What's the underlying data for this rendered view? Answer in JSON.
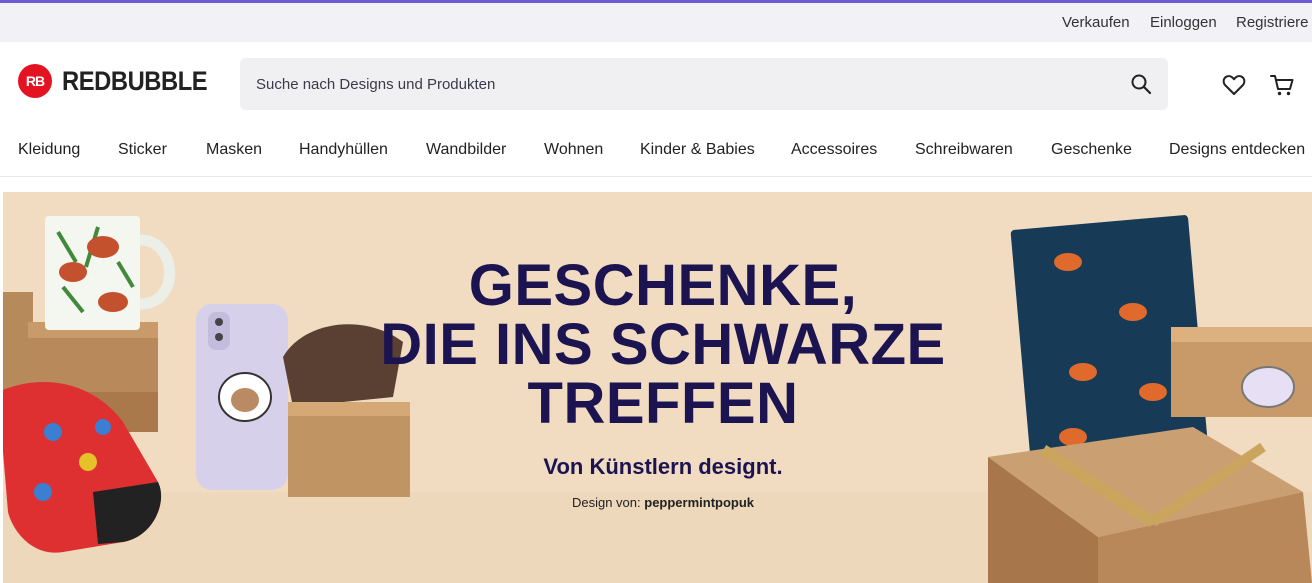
{
  "utility": {
    "sell": "Verkaufen",
    "login": "Einloggen",
    "register": "Registriere"
  },
  "brand": {
    "logo_mark": "RB",
    "logo_text": "REDBUBBLE",
    "accent": "#6e5bd6",
    "brand_red": "#e41321"
  },
  "search": {
    "placeholder": "Suche nach Designs und Produkten"
  },
  "nav": {
    "items": [
      "Kleidung",
      "Sticker",
      "Masken",
      "Handyhüllen",
      "Wandbilder",
      "Wohnen",
      "Kinder & Babies",
      "Accessoires",
      "Schreibwaren",
      "Geschenke",
      "Designs entdecken"
    ]
  },
  "hero": {
    "title_line1": "GESCHENKE,",
    "title_line2": "DIE INS SCHWARZE",
    "title_line3": "TREFFEN",
    "subtitle": "Von Künstlern designt.",
    "credit_prefix": "Design von:",
    "credit_artist": "peppermintpopuk",
    "title_color": "#1c1450",
    "background": "#f1dcc2"
  },
  "icons": {
    "search": "search-icon",
    "wishlist": "heart-icon",
    "cart": "cart-icon"
  }
}
